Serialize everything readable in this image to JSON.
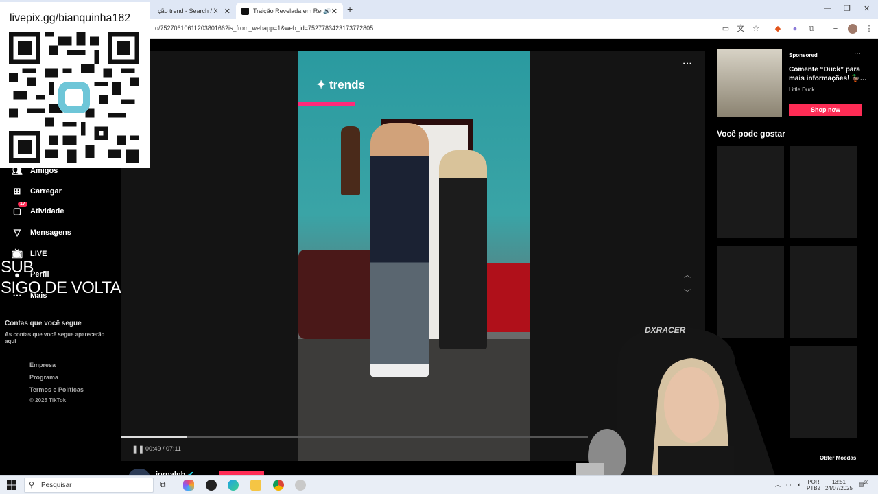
{
  "browser": {
    "tabs": [
      {
        "label": "ção trend - Search / X"
      },
      {
        "label": "Traição Revelada em Reuni"
      }
    ],
    "url": "o/7527061061120380166?is_from_webapp=1&web_id=7527783423173772805"
  },
  "overlay": {
    "qr_link": "livepix.gg/bianquinha182",
    "sub_line1": "SUB",
    "sub_line2": "SIGO DE VOLTA"
  },
  "sidebar": {
    "items": [
      {
        "label": "Amigos"
      },
      {
        "label": "Carregar"
      },
      {
        "label": "Atividade",
        "badge": "17"
      },
      {
        "label": "Mensagens"
      },
      {
        "label": "LIVE"
      },
      {
        "label": "Perfil"
      },
      {
        "label": "Mais"
      }
    ],
    "following_title": "Contas que você segue",
    "following_hint": "As contas que você segue aparecerão aqui",
    "footer": [
      "Empresa",
      "Programa",
      "Termos e Políticas"
    ],
    "copyright": "© 2025 TikTok"
  },
  "video": {
    "watermark": "trends",
    "time": "00:49 / 07:11",
    "progress_fraction": 0.14,
    "author": "jornalnh"
  },
  "right": {
    "sponsored_label": "Sponsored",
    "ad_title": "Comente “Duck” para mais informações! 🦆…",
    "ad_brand": "Little Duck",
    "shop_button": "Shop now",
    "recommend_title": "Você pode gostar",
    "coins_button": "Obter Moedas"
  },
  "taskbar": {
    "search_placeholder": "Pesquisar",
    "lang_line1": "POR",
    "lang_line2": "PTB2",
    "time": "13:51",
    "date": "24/07/2025",
    "notif_count": "20"
  }
}
